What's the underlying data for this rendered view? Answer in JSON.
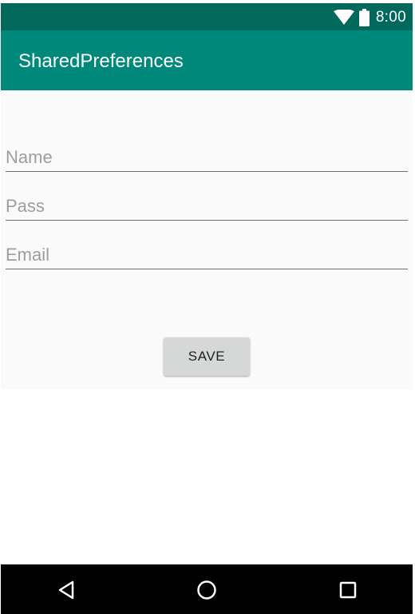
{
  "status_bar": {
    "time": "8:00",
    "icons": [
      "wifi-icon",
      "battery-icon"
    ]
  },
  "app_bar": {
    "title": "SharedPreferences"
  },
  "form": {
    "name": {
      "placeholder": "Name",
      "value": ""
    },
    "pass": {
      "placeholder": "Pass",
      "value": ""
    },
    "email": {
      "placeholder": "Email",
      "value": ""
    },
    "save_label": "SAVE"
  },
  "nav_bar": {
    "buttons": [
      "back-icon",
      "home-icon",
      "recents-icon"
    ]
  },
  "colors": {
    "status_bar": "#00695c",
    "app_bar": "#00897b",
    "content_bg": "#fafafa",
    "nav_bar": "#000000",
    "button": "#d6d7d7"
  }
}
